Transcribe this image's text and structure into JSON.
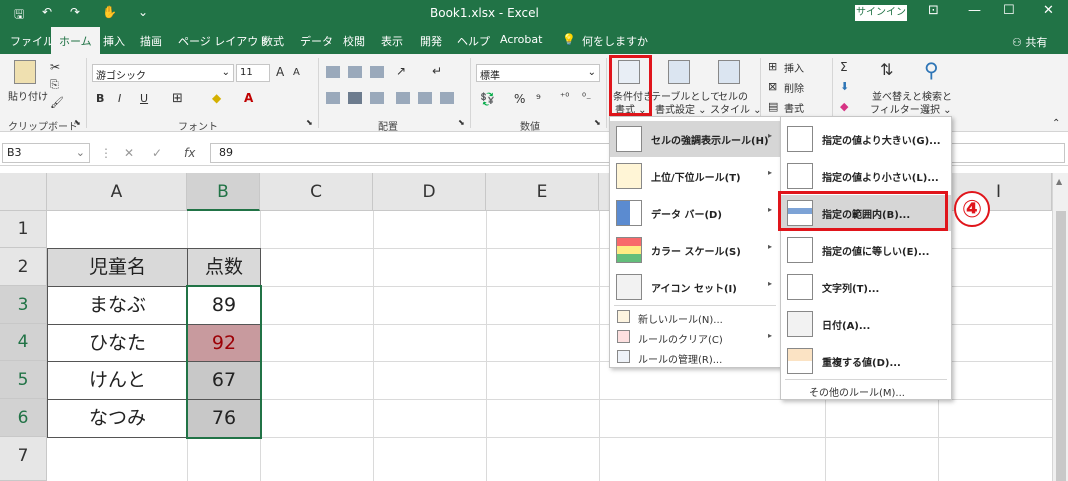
{
  "titlebar": {
    "title": "Book1.xlsx  -  Excel",
    "signin": "サインイン",
    "minimize": "—",
    "maximize": "☐",
    "close": "✕"
  },
  "tabs": [
    "ファイル",
    "ホーム",
    "挿入",
    "描画",
    "ページ レイアウト",
    "数式",
    "データ",
    "校閲",
    "表示",
    "開発",
    "ヘルプ",
    "Acrobat"
  ],
  "active_tab_index": 1,
  "tell_me": "何をしますか",
  "share": "共有",
  "ribbon": {
    "clipboard": {
      "paste": "貼り付け",
      "label": "クリップボード"
    },
    "font": {
      "name": "游ゴシック",
      "size": "11",
      "label": "フォント",
      "bold": "B",
      "italic": "I",
      "underline": "U",
      "grow": "A",
      "shrink": "A"
    },
    "alignment": {
      "label": "配置"
    },
    "number": {
      "format": "標準",
      "label": "数値",
      "percent": "%",
      "comma": "⁹"
    },
    "styles": {
      "conditional": "条件付き",
      "conditional2": "書式 ⌄",
      "table": "テーブルとして",
      "table2": "書式設定 ⌄",
      "cell": "セルの",
      "cell2": "スタイル ⌄"
    },
    "cells": {
      "insert": "挿入",
      "delete": "削除",
      "format": "書式"
    },
    "editing": {
      "sort": "並べ替えと",
      "sort2": "フィルター ⌄",
      "find": "検索と",
      "find2": "選択 ⌄"
    }
  },
  "formula_bar": {
    "name_box": "B3",
    "fx": "fx",
    "value": "89"
  },
  "columns": [
    "A",
    "B",
    "C",
    "D",
    "E",
    "I"
  ],
  "rows": [
    "1",
    "2",
    "3",
    "4",
    "5",
    "6",
    "7"
  ],
  "table": {
    "headers": [
      "児童名",
      "点数"
    ],
    "records": [
      {
        "name": "まなぶ",
        "score": "89"
      },
      {
        "name": "ひなた",
        "score": "92"
      },
      {
        "name": "けんと",
        "score": "67"
      },
      {
        "name": "なつみ",
        "score": "76"
      }
    ]
  },
  "cf_menu": {
    "items": [
      {
        "label": "セルの強調表示ルール(H)",
        "arrow": "▸"
      },
      {
        "label": "上位/下位ルール(T)",
        "arrow": "▸"
      },
      {
        "label": "データ バー(D)",
        "arrow": "▸"
      },
      {
        "label": "カラー スケール(S)",
        "arrow": "▸"
      },
      {
        "label": "アイコン セット(I)",
        "arrow": "▸"
      }
    ],
    "small_items": [
      {
        "label": "新しいルール(N)..."
      },
      {
        "label": "ルールのクリア(C)",
        "arrow": "▸"
      },
      {
        "label": "ルールの管理(R)..."
      }
    ]
  },
  "sub_menu": {
    "items": [
      {
        "label": "指定の値より大きい(G)..."
      },
      {
        "label": "指定の値より小さい(L)..."
      },
      {
        "label": "指定の範囲内(B)..."
      },
      {
        "label": "指定の値に等しい(E)..."
      },
      {
        "label": "文字列(T)..."
      },
      {
        "label": "日付(A)..."
      },
      {
        "label": "重複する値(D)..."
      }
    ],
    "more": "その他のルール(M)..."
  },
  "step_marker": "④"
}
